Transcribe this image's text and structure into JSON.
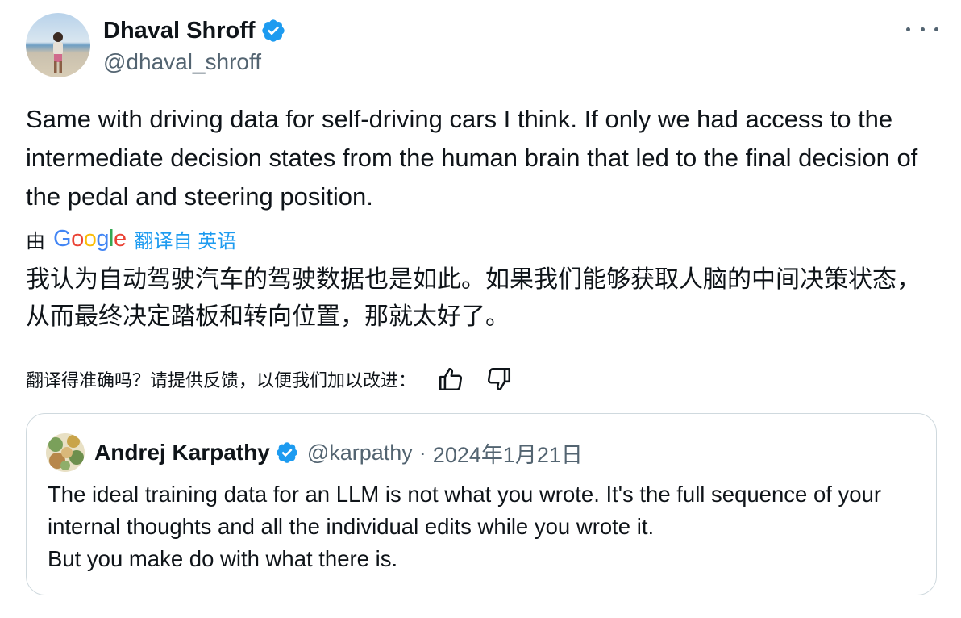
{
  "author": {
    "name": "Dhaval Shroff",
    "handle": "@dhaval_shroff"
  },
  "tweet": {
    "text": "Same with driving data for self-driving cars I think. If only we had access to the intermediate decision states from the human brain that led to the final decision of the pedal and steering position."
  },
  "translation": {
    "prefix": "由",
    "provider": "Google",
    "link_label": "翻译自 英语",
    "text": "我认为自动驾驶汽车的驾驶数据也是如此。如果我们能够获取人脑的中间决策状态，从而最终决定踏板和转向位置，那就太好了。",
    "feedback_prompt": "翻译得准确吗？请提供反馈，以便我们加以改进："
  },
  "quote": {
    "name": "Andrej Karpathy",
    "handle": "@karpathy",
    "separator": "·",
    "date": "2024年1月21日",
    "text": "The ideal training data for an LLM is not what you wrote. It's the full sequence of your internal thoughts and all the individual edits while you wrote it.\nBut you make do with what there is."
  },
  "icons": {
    "verified": "verified-badge-icon",
    "more": "more-icon",
    "thumbs_up": "thumbs-up-icon",
    "thumbs_down": "thumbs-down-icon"
  },
  "colors": {
    "text_primary": "#0f1419",
    "text_secondary": "#536471",
    "accent": "#1d9bf0",
    "border": "#cfd9de"
  }
}
